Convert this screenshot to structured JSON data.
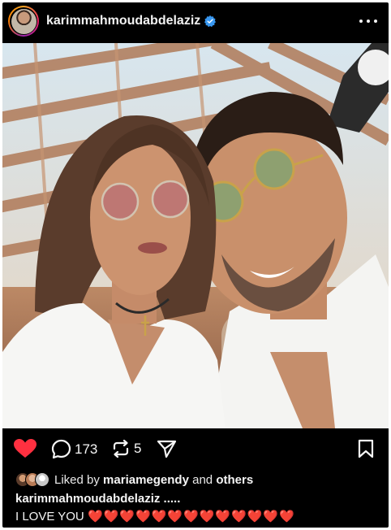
{
  "post": {
    "username": "karimmahmoudabdelaziz",
    "verified": true,
    "comment_count": "173",
    "repost_count": "5",
    "liked_by_prefix": "Liked by",
    "liked_by_user": "mariamegendy",
    "liked_by_and": "and",
    "liked_by_others": "others",
    "caption_user": "karimmahmoudabdelaziz .....",
    "caption_text": "I LOVE YOU",
    "caption_hearts": "❤️❤️❤️❤️❤️❤️❤️❤️❤️❤️❤️❤️❤️"
  },
  "icons": {
    "more": "more-options-icon",
    "like": "heart-filled-icon",
    "comment": "comment-bubble-icon",
    "repost": "repost-icon",
    "share": "send-paper-plane-icon",
    "save": "bookmark-icon",
    "verified": "verified-badge-icon"
  },
  "colors": {
    "background": "#000000",
    "like_red": "#ff3040",
    "verified_blue": "#3897f0",
    "text": "#f5f5f5"
  }
}
